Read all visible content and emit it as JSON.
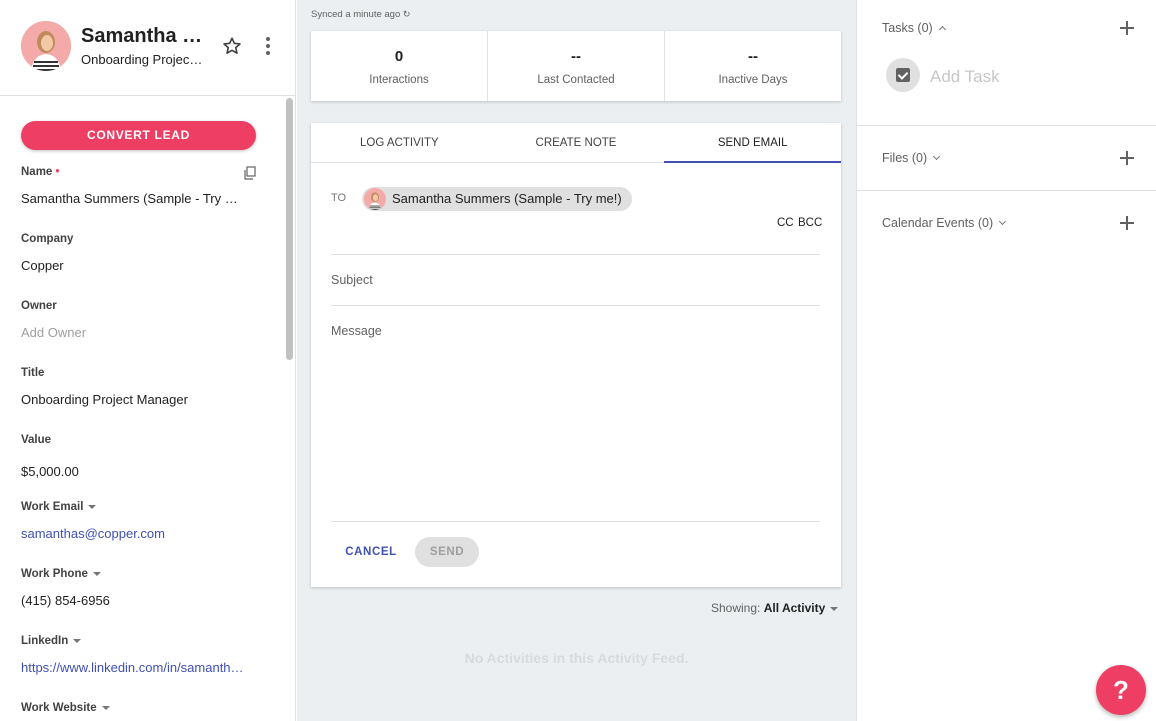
{
  "header": {
    "name": "Samantha Summers",
    "subtitle": "Onboarding Project Manager"
  },
  "actions": {
    "convert_label": "CONVERT LEAD"
  },
  "fields": {
    "name_label": "Name",
    "name_value": "Samantha Summers (Sample - Try me!)",
    "company_label": "Company",
    "company_value": "Copper",
    "owner_label": "Owner",
    "owner_placeholder": "Add Owner",
    "title_label": "Title",
    "title_value": "Onboarding Project Manager",
    "value_label": "Value",
    "value_value": "$5,000.00",
    "work_email_label": "Work Email",
    "work_email_value": "samanthas@copper.com",
    "work_phone_label": "Work Phone",
    "work_phone_value": "(415) 854-6956",
    "linkedin_label": "LinkedIn",
    "linkedin_value": "https://www.linkedin.com/in/samanthasummers",
    "work_website_label": "Work Website"
  },
  "center": {
    "synced_text": "Synced a minute ago",
    "stats": [
      {
        "value": "0",
        "label": "Interactions"
      },
      {
        "value": "--",
        "label": "Last Contacted"
      },
      {
        "value": "--",
        "label": "Inactive Days"
      }
    ],
    "tabs": [
      "LOG ACTIVITY",
      "CREATE NOTE",
      "SEND EMAIL"
    ],
    "active_tab": "SEND EMAIL",
    "email": {
      "to_label": "TO",
      "recipient": "Samantha Summers (Sample - Try me!)",
      "cc_label": "CC",
      "bcc_label": "BCC",
      "subject_placeholder": "Subject",
      "message_placeholder": "Message",
      "cancel_label": "CANCEL",
      "send_label": "SEND"
    },
    "showing_label": "Showing:",
    "showing_value": "All Activity",
    "empty_feed": "No Activities in this Activity Feed."
  },
  "right": {
    "tasks_title": "Tasks (0)",
    "add_task": "Add Task",
    "files_title": "Files (0)",
    "calendar_title": "Calendar Events (0)"
  },
  "help_label": "?",
  "colors": {
    "accent_pink": "#ef3e64",
    "accent_blue": "#3f51b5",
    "panel_bg": "#eceff1"
  }
}
